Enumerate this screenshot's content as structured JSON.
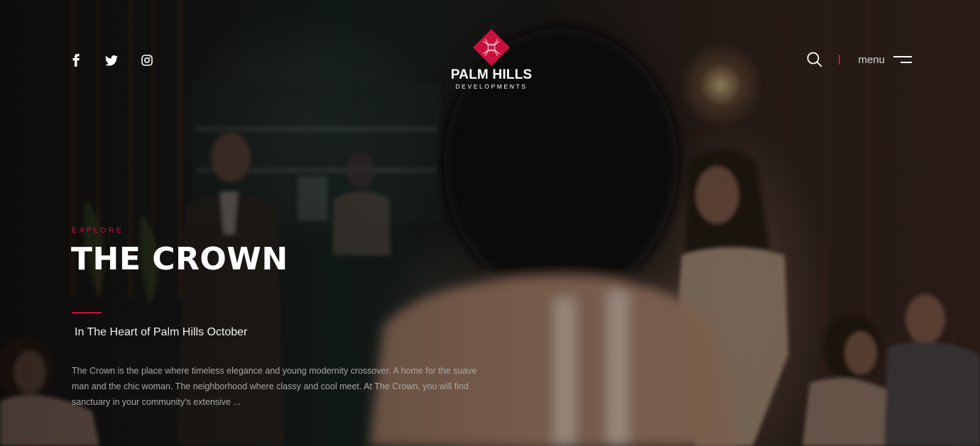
{
  "header": {
    "social_icons": [
      "facebook-icon",
      "twitter-icon",
      "instagram-icon"
    ],
    "logo": {
      "name": "PALM HILLS",
      "tagline": "DEVELOPMENTS",
      "mark_color": "#c8103e"
    },
    "search_icon": "search-icon",
    "menu_label": "menu",
    "menu_icon": "hamburger-menu-icon"
  },
  "hero": {
    "eyebrow": "EXPLORE",
    "title": "THE CROWN",
    "subtitle": "In The Heart of Palm Hills October",
    "description": "The Crown is the place where timeless elegance and young modernity crossover. A home for the suave man and the chic woman. The neighborhood where classy and cool meet. At The Crown, you will find sanctuary in your community's extensive ..."
  },
  "colors": {
    "accent": "#c8103e",
    "text_primary": "#ffffff",
    "text_muted": "#a8a8a8"
  }
}
